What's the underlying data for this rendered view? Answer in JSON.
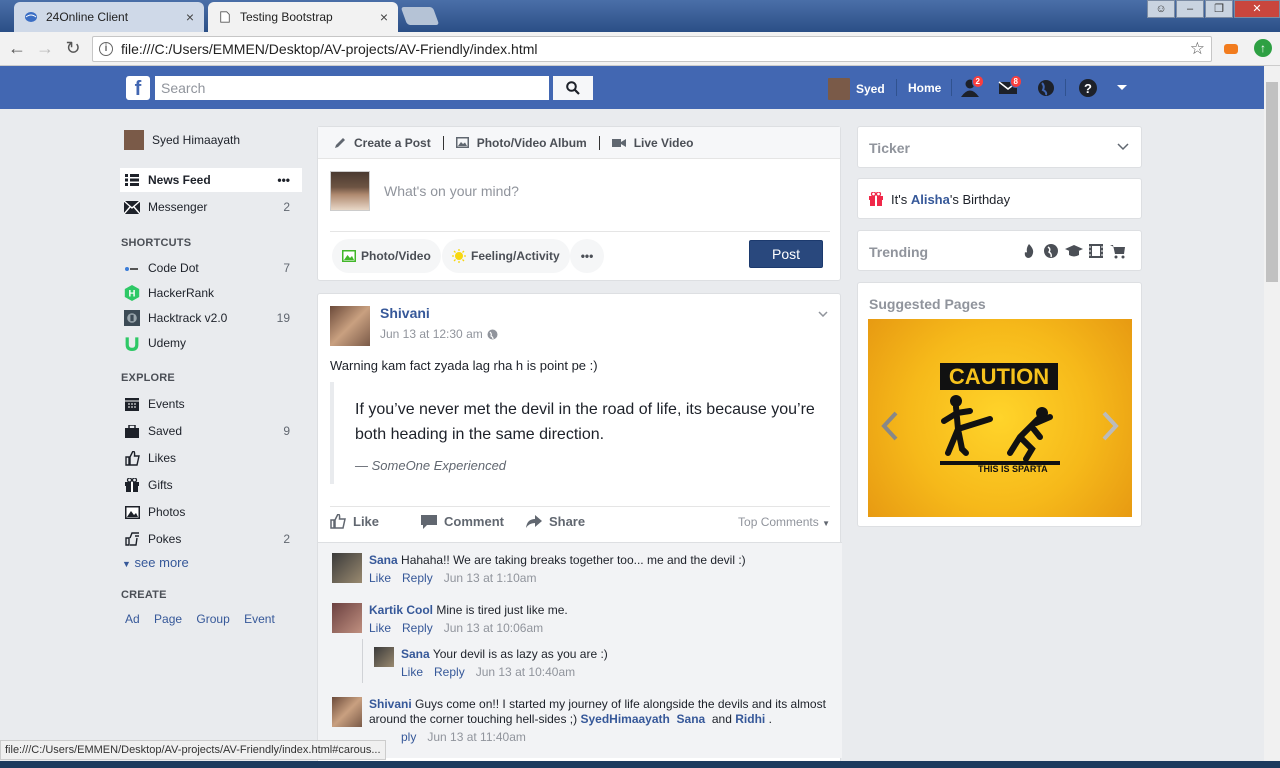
{
  "browser": {
    "tabs": [
      {
        "title": "24Online Client",
        "close": "×"
      },
      {
        "title": "Testing Bootstrap",
        "close": "×"
      }
    ],
    "url": "file:///C:/Users/EMMEN/Desktop/AV-projects/AV-Friendly/index.html",
    "status_url": "file:///C:/Users/EMMEN/Desktop/AV-projects/AV-Friendly/index.html#carous..."
  },
  "topbar": {
    "search_placeholder": "Search",
    "user_name": "Syed",
    "home_label": "Home",
    "friend_requests_badge": "2",
    "messages_badge": "8",
    "brand_color": "#4267b2"
  },
  "sidebar": {
    "profile_name": "Syed Himaayath",
    "main": [
      {
        "label": "News Feed",
        "icon": "news-feed-icon",
        "more": "•••"
      },
      {
        "label": "Messenger",
        "icon": "messenger-icon",
        "count": "2"
      }
    ],
    "shortcuts_heading": "SHORTCUTS",
    "shortcuts": [
      {
        "label": "Code Dot",
        "count": "7"
      },
      {
        "label": "HackerRank",
        "count": ""
      },
      {
        "label": "Hacktrack v2.0",
        "count": "19"
      },
      {
        "label": "Udemy",
        "count": ""
      }
    ],
    "explore_heading": "EXPLORE",
    "explore": [
      {
        "label": "Events",
        "icon": "calendar-icon",
        "count": ""
      },
      {
        "label": "Saved",
        "icon": "briefcase-icon",
        "count": "9"
      },
      {
        "label": "Likes",
        "icon": "thumbs-up-icon",
        "count": ""
      },
      {
        "label": "Gifts",
        "icon": "gift-icon",
        "count": ""
      },
      {
        "label": "Photos",
        "icon": "photo-icon",
        "count": ""
      },
      {
        "label": "Pokes",
        "icon": "poke-icon",
        "count": "2"
      }
    ],
    "see_more": "see more",
    "create_heading": "CREATE",
    "create_links": [
      "Ad",
      "Page",
      "Group",
      "Event"
    ]
  },
  "composer": {
    "tabs": [
      "Create a Post",
      "Photo/Video Album",
      "Live Video"
    ],
    "placeholder": "What's on your mind?",
    "photo_video": "Photo/Video",
    "feeling": "Feeling/Activity",
    "more": "•••",
    "post_button": "Post"
  },
  "post": {
    "author": "Shivani",
    "time": "Jun 13 at 12:30 am",
    "text": "Warning kam fact zyada lag rha h is point pe :)",
    "quote": "If you’ve never met the devil in the road of life, its because you’re both heading in the same direction.",
    "quote_source": "— SomeOne Experienced",
    "actions": {
      "like": "Like",
      "comment": "Comment",
      "share": "Share",
      "top_comments": "Top Comments"
    }
  },
  "comments": [
    {
      "name": "Sana",
      "text": "Hahaha!! We are taking breaks together too... me and the devil :)",
      "like": "Like",
      "reply": "Reply",
      "time": "Jun 13 at 1:10am"
    },
    {
      "name": "Kartik Cool",
      "text": "Mine is tired just like me.",
      "like": "Like",
      "reply": "Reply",
      "time": "Jun 13 at 10:06am"
    },
    {
      "name": "Sana",
      "text": "Your devil is as lazy as you are :)",
      "like": "Like",
      "reply": "Reply",
      "time": "Jun 13 at 10:40am"
    },
    {
      "name": "Shivani",
      "text": "Guys come on!! I started my journey of life alongside the devils and its almost around the corner touching hell-sides ;)",
      "tag1": "SyedHimaayath",
      "tag2": "Sana",
      "and": "and",
      "tag3": "Ridhi",
      "end": ".",
      "reply_partial": "ply",
      "time": "Jun 13 at 11:40am"
    }
  ],
  "right": {
    "ticker": "Ticker",
    "birthday_prefix": "It's",
    "birthday_name": "Alisha",
    "birthday_suffix": "'s Birthday",
    "trending": "Trending",
    "suggested": "Suggested Pages",
    "caution_title": "CAUTION",
    "caution_caption": "THIS IS SPARTA"
  }
}
